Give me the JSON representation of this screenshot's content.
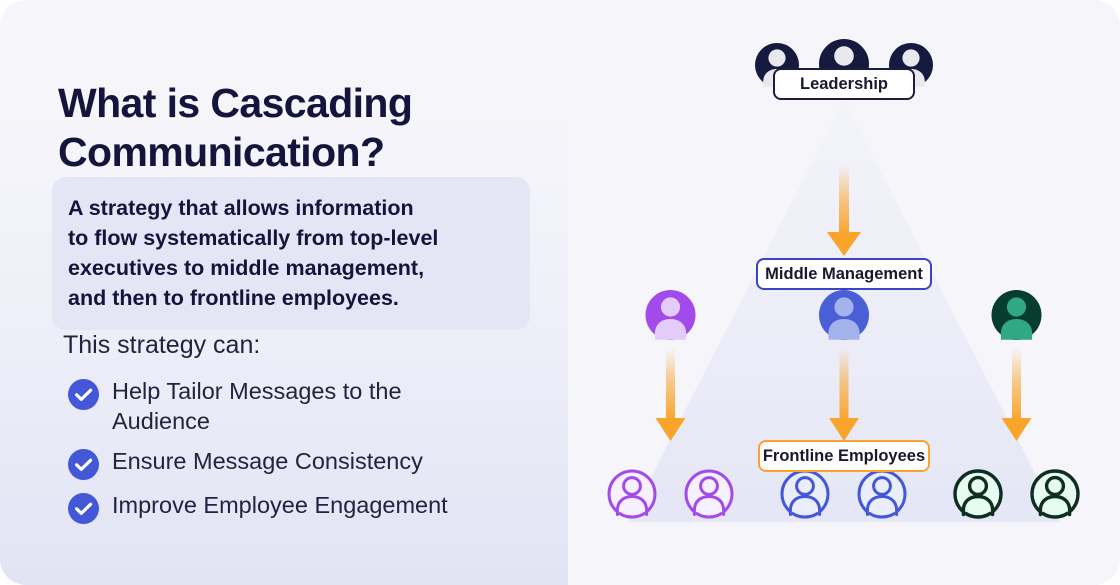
{
  "left": {
    "title": "What is Cascading Communication?",
    "definition": "A strategy that allows information\nto flow systematically from top-level\nexecutives to middle management,\nand then to frontline employees.",
    "strategy_lead": "This strategy can:",
    "benefits": [
      {
        "label": "Help Tailor Messages to the\nAudience",
        "icon": "check-circle-icon"
      },
      {
        "label": "Ensure Message Consistency",
        "icon": "check-circle-icon"
      },
      {
        "label": "Improve Employee Engagement",
        "icon": "check-circle-icon"
      }
    ]
  },
  "diagram": {
    "levels": [
      {
        "id": "leadership",
        "label": "Leadership",
        "border_color": "#1c1c3e",
        "avatar_style": "solid",
        "avatar_color": "#151a3e",
        "avatar_glyph_color": "#e8e8ee",
        "avatar_count": 3
      },
      {
        "id": "middle-management",
        "label": "Middle Management",
        "border_color": "#3a43c9",
        "avatar_style": "solid",
        "avatar_count": 3,
        "avatars": [
          {
            "color": "#a24bea",
            "glyph_color": "#e3cbfa"
          },
          {
            "color": "#4a5ed6",
            "glyph_color": "#a5b3ec"
          },
          {
            "color": "#063d2c",
            "glyph_color": "#2fa883"
          }
        ]
      },
      {
        "id": "frontline-employees",
        "label": "Frontline Employees",
        "border_color": "#fba32c",
        "avatar_style": "outline",
        "avatar_count": 6,
        "avatars": [
          {
            "color": "#a24bea",
            "fill": "#f7f0fe"
          },
          {
            "color": "#a24bea",
            "fill": "#f7f0fe"
          },
          {
            "color": "#4457d8",
            "fill": "#eaeefb"
          },
          {
            "color": "#4457d8",
            "fill": "#eaeefb"
          },
          {
            "color": "#0d2e21",
            "fill": "#e8fbf2"
          },
          {
            "color": "#0d2e21",
            "fill": "#e8fbf2"
          }
        ]
      }
    ],
    "arrows": [
      {
        "name": "arrow-leadership-to-middle",
        "color": "#f9a42a"
      },
      {
        "name": "arrow-middle-left-to-frontline",
        "color": "#f9a42a"
      },
      {
        "name": "arrow-middle-center-to-frontline",
        "color": "#f9a42a"
      },
      {
        "name": "arrow-middle-right-to-frontline",
        "color": "#f9a42a"
      }
    ]
  },
  "colors": {
    "title": "#14143c",
    "accent_blue": "#4457d8",
    "accent_orange": "#fba32c",
    "accent_purple": "#a24bea",
    "accent_green": "#0d2e21",
    "panel_left_top": "#f7f7fb",
    "panel_left_bottom": "#e2e4f4",
    "panel_right": "#f5f5fa",
    "definition_box": "#e4e5f5"
  }
}
